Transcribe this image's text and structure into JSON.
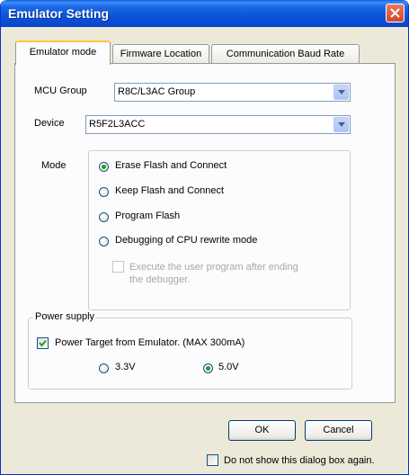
{
  "window": {
    "title": "Emulator Setting"
  },
  "tabs": [
    {
      "label": "Emulator mode",
      "active": true
    },
    {
      "label": "Firmware Location",
      "active": false
    },
    {
      "label": "Communication Baud Rate",
      "active": false
    }
  ],
  "mcu_group": {
    "label": "MCU Group",
    "value": "R8C/L3AC Group"
  },
  "device": {
    "label": "Device",
    "value": "R5F2L3ACC"
  },
  "mode": {
    "label": "Mode",
    "options": [
      {
        "label": "Erase Flash and Connect",
        "checked": true
      },
      {
        "label": "Keep Flash and Connect",
        "checked": false
      },
      {
        "label": "Program Flash",
        "checked": false
      },
      {
        "label": "Debugging of CPU rewrite mode",
        "checked": false
      }
    ],
    "execute_after_end": {
      "line1": "Execute the user program after ending",
      "line2": "the debugger.",
      "checked": false,
      "enabled": false
    }
  },
  "power_supply": {
    "title": "Power supply",
    "power_target": {
      "label": "Power Target from Emulator. (MAX 300mA)",
      "checked": true
    },
    "voltages": [
      {
        "label": "3.3V",
        "checked": false
      },
      {
        "label": "5.0V",
        "checked": true
      }
    ]
  },
  "buttons": {
    "ok": "OK",
    "cancel": "Cancel"
  },
  "dont_show": {
    "label": "Do not show this dialog box again.",
    "checked": false
  }
}
